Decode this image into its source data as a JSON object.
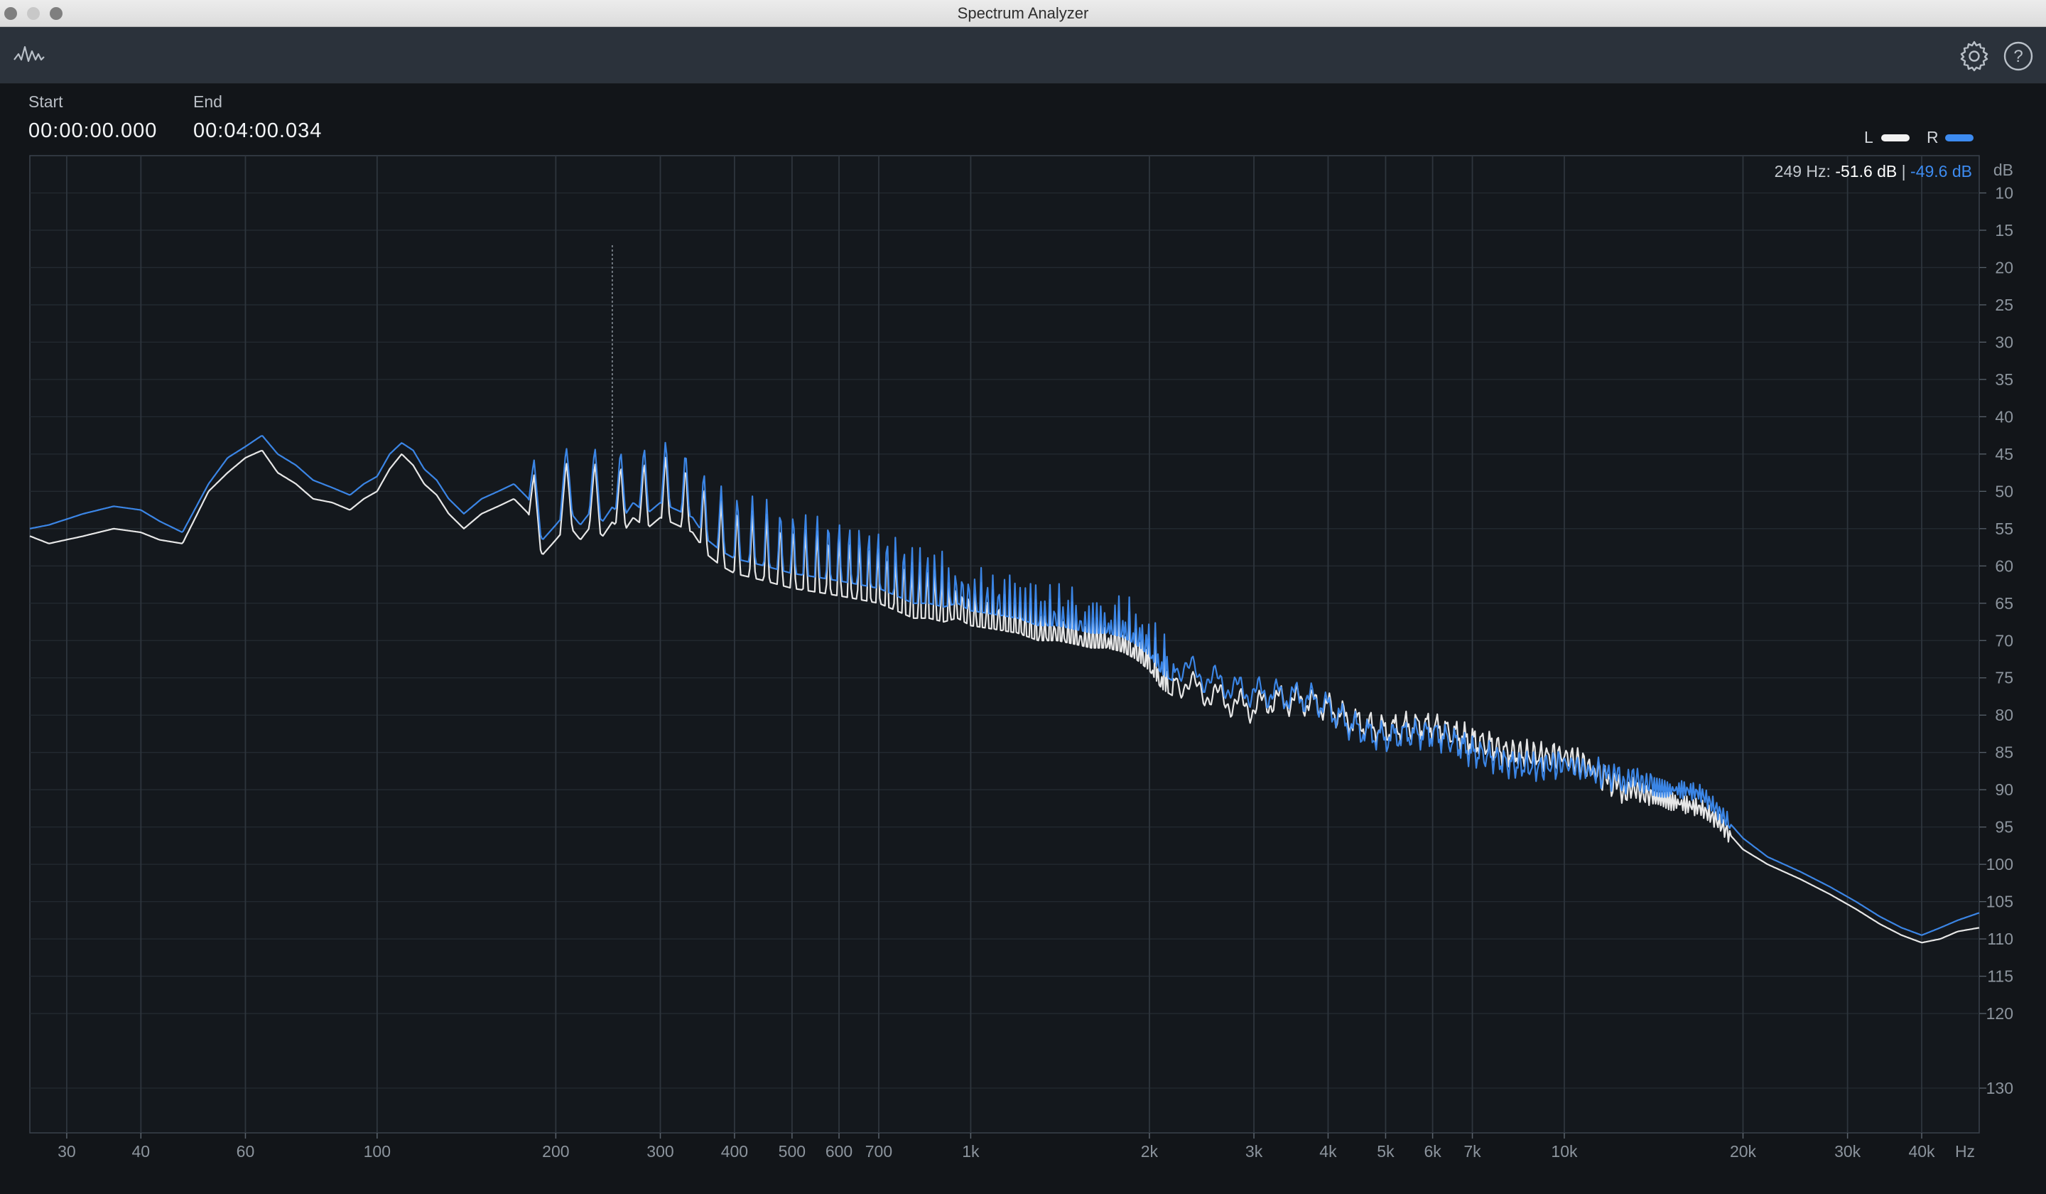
{
  "window": {
    "title": "Spectrum Analyzer"
  },
  "toolbar": {
    "icons": [
      "waveform-icon",
      "gear-icon",
      "help-icon"
    ]
  },
  "time_range": {
    "start_label": "Start",
    "start_value": "00:00:00.000",
    "end_label": "End",
    "end_value": "00:04:00.034"
  },
  "legend": {
    "left_label": "L",
    "right_label": "R",
    "left_color": "#f2f2f2",
    "right_color": "#3d8bf0"
  },
  "readout": {
    "freq": "249 Hz:",
    "left_db": "-51.6 dB",
    "separator": "|",
    "right_db": "-49.6 dB"
  },
  "chart_data": {
    "type": "line",
    "x_scale": "log",
    "xlim": [
      26,
      50000
    ],
    "ylim": [
      -136,
      -5
    ],
    "x_ticks": [
      {
        "v": 30,
        "label": "30"
      },
      {
        "v": 40,
        "label": "40"
      },
      {
        "v": 60,
        "label": "60"
      },
      {
        "v": 100,
        "label": "100"
      },
      {
        "v": 200,
        "label": "200"
      },
      {
        "v": 300,
        "label": "300"
      },
      {
        "v": 400,
        "label": "400"
      },
      {
        "v": 500,
        "label": "500"
      },
      {
        "v": 600,
        "label": "600"
      },
      {
        "v": 700,
        "label": "700"
      },
      {
        "v": 1000,
        "label": "1k"
      },
      {
        "v": 2000,
        "label": "2k"
      },
      {
        "v": 3000,
        "label": "3k"
      },
      {
        "v": 4000,
        "label": "4k"
      },
      {
        "v": 5000,
        "label": "5k"
      },
      {
        "v": 6000,
        "label": "6k"
      },
      {
        "v": 7000,
        "label": "7k"
      },
      {
        "v": 10000,
        "label": "10k"
      },
      {
        "v": 20000,
        "label": "20k"
      },
      {
        "v": 30000,
        "label": "30k"
      },
      {
        "v": 40000,
        "label": "40k"
      }
    ],
    "x_unit": "Hz",
    "y_unit": "dB",
    "y_ticks": [
      -10,
      -15,
      -20,
      -25,
      -30,
      -35,
      -40,
      -45,
      -50,
      -55,
      -60,
      -65,
      -70,
      -75,
      -80,
      -85,
      -90,
      -95,
      -100,
      -105,
      -110,
      -115,
      -120,
      -130
    ],
    "cursor_x": 249,
    "grid": true,
    "legend_position": "top-right",
    "series": [
      {
        "name": "L",
        "color": "#f2f2f2",
        "points": [
          [
            26,
            -56
          ],
          [
            28,
            -57
          ],
          [
            32,
            -56
          ],
          [
            36,
            -55
          ],
          [
            40,
            -55.5
          ],
          [
            43,
            -56.5
          ],
          [
            47,
            -57
          ],
          [
            52,
            -50
          ],
          [
            56,
            -47.5
          ],
          [
            60,
            -45.5
          ],
          [
            64,
            -44.5
          ],
          [
            68,
            -47.5
          ],
          [
            73,
            -49
          ],
          [
            78,
            -51
          ],
          [
            84,
            -51.5
          ],
          [
            90,
            -52.5
          ],
          [
            95,
            -51
          ],
          [
            100,
            -50
          ],
          [
            105,
            -47
          ],
          [
            110,
            -45
          ],
          [
            115,
            -46.5
          ],
          [
            120,
            -49
          ],
          [
            126,
            -50.5
          ],
          [
            132,
            -53
          ],
          [
            140,
            -55
          ],
          [
            150,
            -53
          ],
          [
            160,
            -52
          ],
          [
            170,
            -51
          ],
          [
            180,
            -53
          ],
          [
            190,
            -56
          ],
          [
            200,
            -54
          ],
          [
            210,
            -52
          ],
          [
            220,
            -54
          ],
          [
            230,
            -52
          ],
          [
            240,
            -53.5
          ],
          [
            249,
            -51.6
          ],
          [
            260,
            -53
          ],
          [
            270,
            -51
          ],
          [
            285,
            -52.5
          ],
          [
            300,
            -51
          ],
          [
            320,
            -52
          ],
          [
            340,
            -53
          ],
          [
            360,
            -56
          ],
          [
            380,
            -57.5
          ],
          [
            400,
            -58.5
          ],
          [
            450,
            -59.5
          ],
          [
            500,
            -60.5
          ],
          [
            550,
            -61
          ],
          [
            600,
            -61.5
          ],
          [
            650,
            -62
          ],
          [
            700,
            -62.5
          ],
          [
            750,
            -63.5
          ],
          [
            800,
            -64.5
          ],
          [
            850,
            -64.5
          ],
          [
            900,
            -65
          ],
          [
            950,
            -64.5
          ],
          [
            1000,
            -65.5
          ],
          [
            1100,
            -66
          ],
          [
            1200,
            -66.5
          ],
          [
            1300,
            -67.5
          ],
          [
            1400,
            -67.5
          ],
          [
            1500,
            -68
          ],
          [
            1600,
            -68.5
          ],
          [
            1700,
            -68.5
          ],
          [
            1800,
            -69
          ],
          [
            1900,
            -70
          ],
          [
            2000,
            -71.5
          ],
          [
            2100,
            -74
          ],
          [
            2200,
            -75
          ],
          [
            2400,
            -76.5
          ],
          [
            2600,
            -77.5
          ],
          [
            2800,
            -78.5
          ],
          [
            3000,
            -79
          ],
          [
            3200,
            -78
          ],
          [
            3400,
            -78
          ],
          [
            3600,
            -78
          ],
          [
            3800,
            -78.5
          ],
          [
            4000,
            -79
          ],
          [
            4300,
            -80.5
          ],
          [
            4700,
            -81.5
          ],
          [
            5000,
            -82
          ],
          [
            5500,
            -81.5
          ],
          [
            6000,
            -81.5
          ],
          [
            6500,
            -82.5
          ],
          [
            7000,
            -83.5
          ],
          [
            7500,
            -84
          ],
          [
            8000,
            -85
          ],
          [
            9000,
            -85.5
          ],
          [
            10000,
            -85.5
          ],
          [
            11000,
            -87
          ],
          [
            12000,
            -89
          ],
          [
            13000,
            -90.5
          ],
          [
            14000,
            -91
          ],
          [
            15000,
            -91.5
          ],
          [
            16000,
            -92
          ],
          [
            17000,
            -92.5
          ],
          [
            18000,
            -94
          ],
          [
            19000,
            -96
          ],
          [
            20000,
            -98
          ],
          [
            22000,
            -100
          ],
          [
            25000,
            -102
          ],
          [
            28000,
            -104
          ],
          [
            31000,
            -106
          ],
          [
            34000,
            -108
          ],
          [
            37000,
            -109.5
          ],
          [
            40000,
            -110.5
          ],
          [
            43000,
            -110
          ],
          [
            46000,
            -109
          ],
          [
            50000,
            -108.5
          ]
        ]
      },
      {
        "name": "R",
        "color": "#3d8bf0",
        "points": [
          [
            26,
            -55
          ],
          [
            28,
            -54.5
          ],
          [
            32,
            -53
          ],
          [
            36,
            -52
          ],
          [
            40,
            -52.5
          ],
          [
            43,
            -54
          ],
          [
            47,
            -55.5
          ],
          [
            52,
            -49
          ],
          [
            56,
            -45.5
          ],
          [
            60,
            -44
          ],
          [
            64,
            -42.5
          ],
          [
            68,
            -45
          ],
          [
            73,
            -46.5
          ],
          [
            78,
            -48.5
          ],
          [
            84,
            -49.5
          ],
          [
            90,
            -50.5
          ],
          [
            95,
            -49
          ],
          [
            100,
            -48
          ],
          [
            105,
            -45
          ],
          [
            110,
            -43.5
          ],
          [
            115,
            -44.5
          ],
          [
            120,
            -47
          ],
          [
            126,
            -48.5
          ],
          [
            132,
            -51
          ],
          [
            140,
            -53
          ],
          [
            150,
            -51
          ],
          [
            160,
            -50
          ],
          [
            170,
            -49
          ],
          [
            180,
            -51
          ],
          [
            190,
            -54
          ],
          [
            200,
            -52
          ],
          [
            210,
            -50
          ],
          [
            220,
            -52
          ],
          [
            230,
            -50
          ],
          [
            240,
            -51.5
          ],
          [
            249,
            -49.6
          ],
          [
            260,
            -51
          ],
          [
            270,
            -49
          ],
          [
            285,
            -50.5
          ],
          [
            300,
            -49
          ],
          [
            320,
            -50
          ],
          [
            340,
            -51
          ],
          [
            360,
            -54
          ],
          [
            380,
            -55.5
          ],
          [
            400,
            -56.5
          ],
          [
            450,
            -57.5
          ],
          [
            500,
            -58.5
          ],
          [
            550,
            -59
          ],
          [
            600,
            -59.5
          ],
          [
            650,
            -60
          ],
          [
            700,
            -60.5
          ],
          [
            750,
            -61.5
          ],
          [
            800,
            -62.5
          ],
          [
            850,
            -62.5
          ],
          [
            900,
            -63
          ],
          [
            950,
            -62.5
          ],
          [
            1000,
            -63.5
          ],
          [
            1100,
            -64
          ],
          [
            1200,
            -64.5
          ],
          [
            1300,
            -65.5
          ],
          [
            1400,
            -65.5
          ],
          [
            1500,
            -66
          ],
          [
            1600,
            -66.5
          ],
          [
            1700,
            -66.5
          ],
          [
            1800,
            -67
          ],
          [
            1900,
            -68
          ],
          [
            2000,
            -69.5
          ],
          [
            2100,
            -72
          ],
          [
            2200,
            -73
          ],
          [
            2400,
            -74.5
          ],
          [
            2600,
            -75.5
          ],
          [
            2800,
            -76.5
          ],
          [
            3000,
            -77
          ],
          [
            3200,
            -77
          ],
          [
            3400,
            -77.5
          ],
          [
            3600,
            -77.5
          ],
          [
            3800,
            -78
          ],
          [
            4000,
            -79
          ],
          [
            4300,
            -81
          ],
          [
            4700,
            -82.5
          ],
          [
            5000,
            -83
          ],
          [
            5500,
            -82.5
          ],
          [
            6000,
            -82.5
          ],
          [
            6500,
            -83.5
          ],
          [
            7000,
            -85
          ],
          [
            7500,
            -85.5
          ],
          [
            8000,
            -86.5
          ],
          [
            9000,
            -87
          ],
          [
            10000,
            -86.5
          ],
          [
            11000,
            -87.5
          ],
          [
            12000,
            -88
          ],
          [
            13000,
            -89
          ],
          [
            14000,
            -89.5
          ],
          [
            15000,
            -90
          ],
          [
            16000,
            -90
          ],
          [
            17000,
            -90.5
          ],
          [
            18000,
            -92.5
          ],
          [
            19000,
            -94.5
          ],
          [
            20000,
            -96.5
          ],
          [
            22000,
            -99
          ],
          [
            25000,
            -101
          ],
          [
            28000,
            -103
          ],
          [
            31000,
            -105
          ],
          [
            34000,
            -107
          ],
          [
            37000,
            -108.5
          ],
          [
            40000,
            -109.5
          ],
          [
            43000,
            -108.5
          ],
          [
            46000,
            -107.5
          ],
          [
            50000,
            -106.5
          ]
        ]
      }
    ]
  }
}
